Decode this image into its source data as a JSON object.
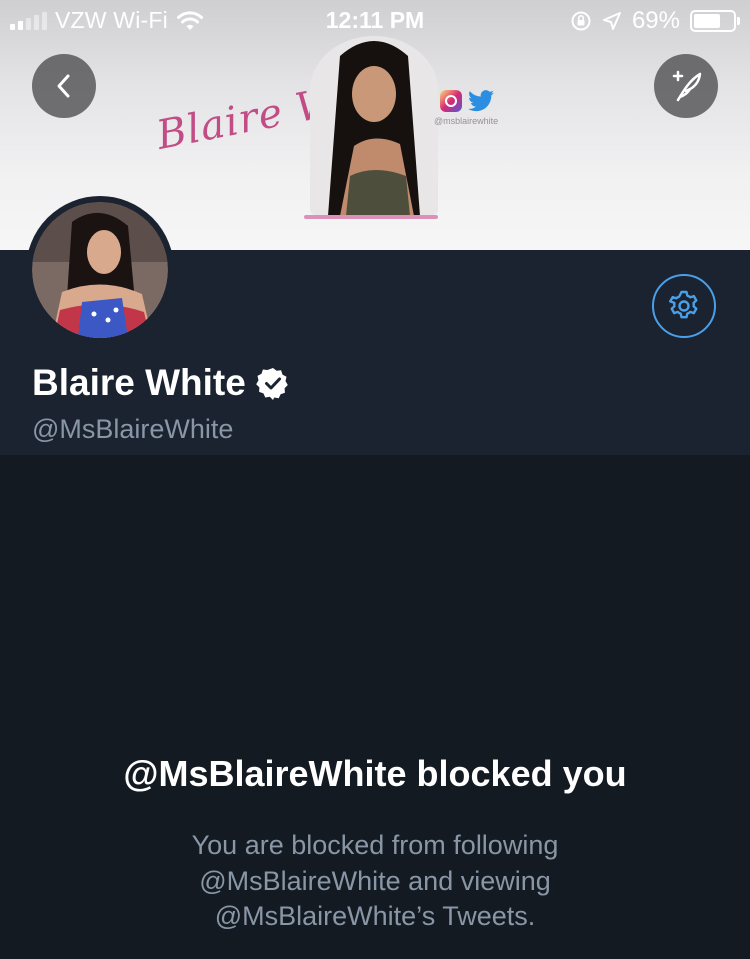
{
  "status_bar": {
    "carrier": "VZW Wi-Fi",
    "time": "12:11 PM",
    "battery": "69%",
    "battery_level": 0.69
  },
  "banner": {
    "logo_text": "Blaire White",
    "social_handle": "@msblairewhite"
  },
  "profile": {
    "name": "Blaire White",
    "handle": "@MsBlaireWhite"
  },
  "blocked": {
    "title": "@MsBlaireWhite blocked you",
    "lines": [
      "You are blocked from following",
      "@MsBlaireWhite and viewing",
      "@MsBlaireWhite’s Tweets."
    ]
  },
  "colors": {
    "background": "#141a22",
    "header_bg": "#1b2230",
    "accent": "#4aa0e8",
    "secondary_text": "#8896a6"
  },
  "icons": {
    "back": "chevron-left-icon",
    "compose": "compose-tweet-icon",
    "settings": "gear-icon",
    "verified": "verified-badge-icon",
    "wifi": "wifi-icon",
    "location": "location-arrow-icon",
    "rotation_lock": "rotation-lock-icon"
  }
}
